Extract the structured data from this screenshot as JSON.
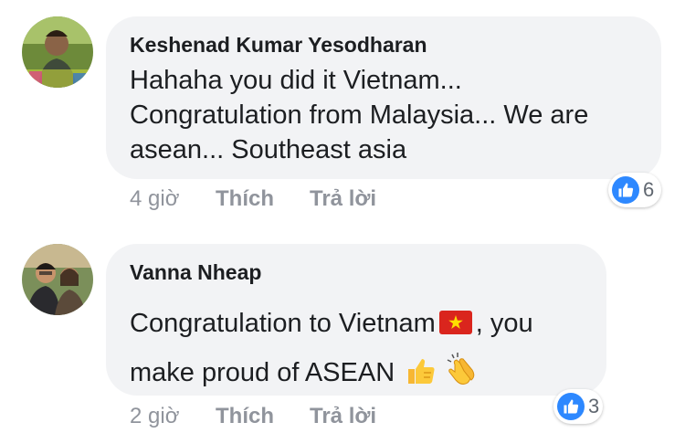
{
  "comments": [
    {
      "author": "Keshenad Kumar Yesodharan",
      "lines": [
        "Hahaha you did it Vietnam...",
        "Congratulation from Malaysia... We are",
        "asean... Southeast asia"
      ],
      "time": "4 giờ",
      "like_label": "Thích",
      "reply_label": "Trả lời",
      "reaction_count": "6"
    },
    {
      "author": "Vanna Nheap",
      "line1": "Congratulation to Vietnam",
      "line1_suffix": ", you",
      "line2": "make proud of ASEAN",
      "time": "2 giờ",
      "like_label": "Thích",
      "reply_label": "Trả lời",
      "reaction_count": "3"
    }
  ],
  "icons": {
    "reaction": "like-icon",
    "flag": "vietnam-flag-icon",
    "emoji1": "thumbs-up-icon",
    "emoji2": "clapping-hands-icon"
  },
  "colors": {
    "bubble": "#f2f3f5",
    "meta_text": "#90949c",
    "like_blue": "#2d88ff"
  }
}
